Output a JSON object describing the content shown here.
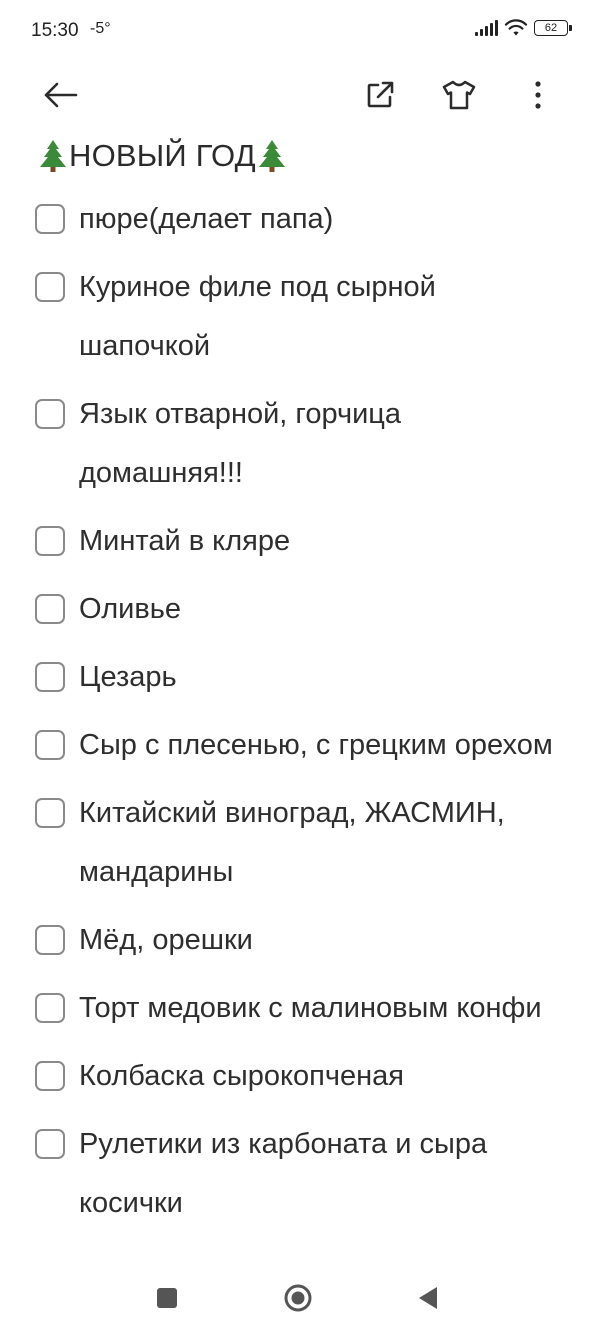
{
  "status_bar": {
    "time": "15:30",
    "temperature": "-5°",
    "battery": "62"
  },
  "toolbar": {
    "back_icon": "arrow-left-icon",
    "share_icon": "share-external-icon",
    "theme_icon": "tshirt-icon",
    "more_icon": "more-vertical-icon"
  },
  "note": {
    "title": "НОВЫЙ ГОД",
    "title_decoration_icon": "christmas-tree-icon",
    "items": [
      {
        "text": "пюре(делает папа)",
        "checked": false
      },
      {
        "text": "Куриное филе под сырной шапочкой",
        "checked": false
      },
      {
        "text": "Язык отварной, горчица домашняя!!!",
        "checked": false
      },
      {
        "text": "Минтай в кляре",
        "checked": false
      },
      {
        "text": "Оливье",
        "checked": false
      },
      {
        "text": "Цезарь",
        "checked": false
      },
      {
        "text": "Сыр с плесенью, с грецким орехом",
        "checked": false
      },
      {
        "text": "Китайский виноград, ЖАСМИН, мандарины",
        "checked": false
      },
      {
        "text": "Мёд, орешки",
        "checked": false
      },
      {
        "text": "Торт медовик с малиновым конфи",
        "checked": false
      },
      {
        "text": "Колбаска сырокопченая",
        "checked": false
      },
      {
        "text": "Рулетики из карбоната и сыра косички",
        "checked": false
      }
    ]
  },
  "nav_bar": {
    "recent_icon": "recent-apps-icon",
    "home_icon": "home-icon",
    "back_icon": "nav-back-icon"
  },
  "colors": {
    "text": "#2e2e2e",
    "checkbox_border": "#8a8a8a",
    "tree_green": "#3a8a3a",
    "background": "#ffffff"
  }
}
